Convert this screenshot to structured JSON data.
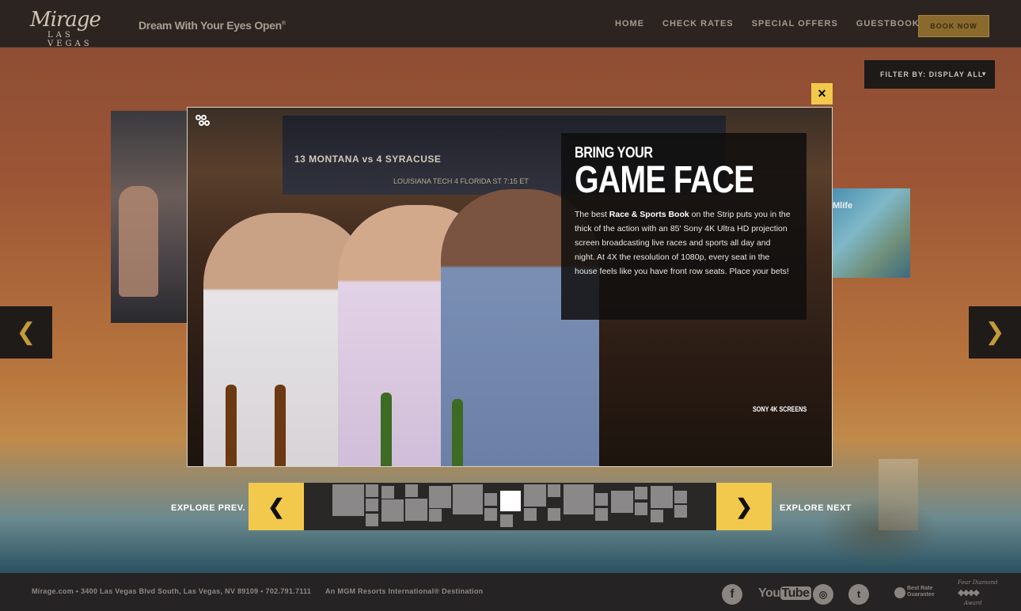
{
  "header": {
    "logo_script": "Mirage",
    "logo_sub": "LAS VEGAS",
    "tagline": "Dream With Your Eyes Open",
    "tagline_mark": "®",
    "nav": [
      "HOME",
      "CHECK RATES",
      "SPECIAL OFFERS",
      "GUESTBOOK"
    ],
    "book_label": "BOOK NOW"
  },
  "filter": {
    "label": "FILTER BY: DISPLAY ALL"
  },
  "side_cards": {
    "right_text": "Mlife"
  },
  "modal": {
    "eyebrow": "BRING YOUR",
    "headline": "GAME FACE",
    "body_lead": "The best ",
    "body_bold": "Race & Sports Book",
    "body_rest": " on the Strip puts you in the thick of the action with an 85' Sony 4K Ultra HD projection screen broadcasting live races and sports all day and night. At 4X the resolution of 1080p, every seat in the house feels like you have front row seats. Place your bets!",
    "badge": "SONY 4K SCREENS",
    "scoreboard_line1": "13 MONTANA vs 4 SYRACUSE",
    "scoreboard_line2": "LOUISIANA TECH    4 FLORIDA ST    7:15 ET",
    "close_glyph": "×"
  },
  "strip": {
    "prev_label": "EXPLORE PREV.",
    "next_label": "EXPLORE NEXT",
    "prev_glyph": "❮",
    "next_glyph": "❯",
    "active_index": 17
  },
  "side_arrows": {
    "left_glyph": "❮",
    "right_glyph": "❯"
  },
  "footer": {
    "address": "Mirage.com • 3400 Las Vegas Blvd South, Las Vegas, NV 89109 • 702.791.7111",
    "mgm": "An MGM Resorts International® Destination",
    "youtube_you": "You",
    "youtube_tube": "Tube",
    "brg_text": "Best Rate Guarantee",
    "fds_top": "Four Diamond",
    "fds_bottom": "Award",
    "icons": [
      "facebook-icon",
      "youtube-icon",
      "instagram-icon",
      "twitter-icon",
      "best-rate-guarantee-icon",
      "four-diamond-award-icon"
    ]
  },
  "colors": {
    "accent": "#f2c94c",
    "gold_button": "#8a6a2c",
    "header_bg": "#2b2420",
    "footer_bg": "#252323"
  }
}
